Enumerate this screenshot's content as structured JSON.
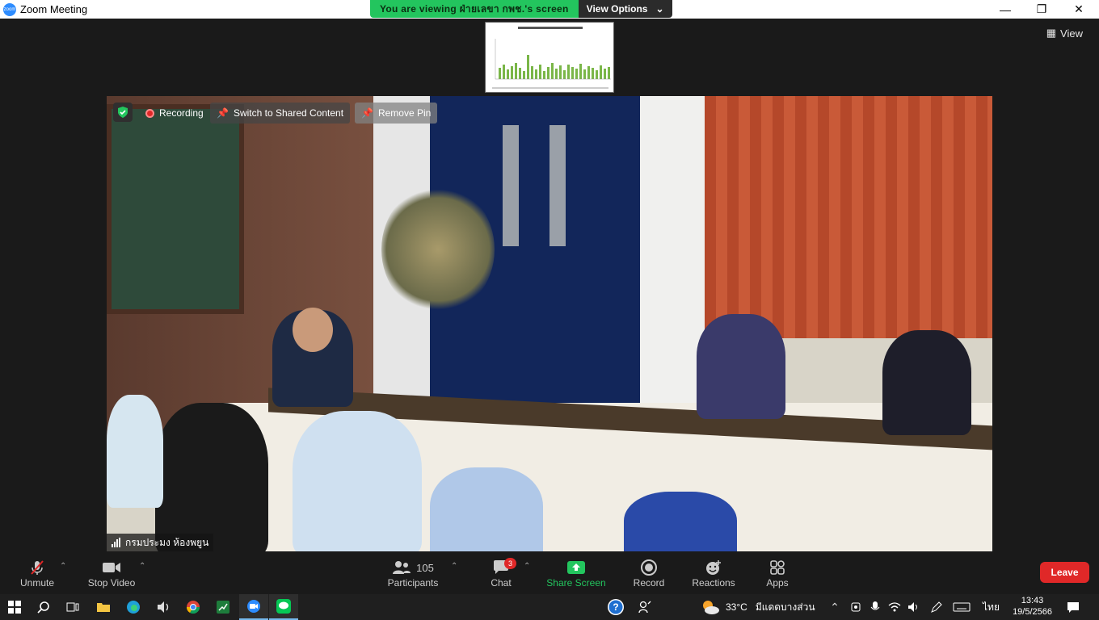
{
  "window": {
    "title": "Zoom Meeting",
    "minimize_icon": "minimize-icon",
    "maximize_icon": "restore-icon",
    "close_icon": "close-icon"
  },
  "share_banner": {
    "viewing_text": "You are viewing ฝ่ายเลขา กพช.'s screen",
    "view_options_label": "View Options"
  },
  "stage": {
    "view_label": "View"
  },
  "video_overlay": {
    "recording_label": "Recording",
    "switch_label": "Switch to Shared Content",
    "remove_pin_label": "Remove Pin",
    "participant_name": "กรมประมง  ห้องพยูน"
  },
  "toolbar": {
    "unmute_label": "Unmute",
    "stop_video_label": "Stop Video",
    "participants_label": "Participants",
    "participants_count": "105",
    "chat_label": "Chat",
    "chat_badge": "3",
    "share_screen_label": "Share Screen",
    "record_label": "Record",
    "reactions_label": "Reactions",
    "apps_label": "Apps",
    "leave_label": "Leave",
    "accent_green": "#23c55e",
    "leave_color": "#e02828"
  },
  "taskbar": {
    "weather_temp": "33°C",
    "weather_text": "มีแดดบางส่วน",
    "language": "ไทย",
    "time": "13:43",
    "date": "19/5/2566"
  }
}
